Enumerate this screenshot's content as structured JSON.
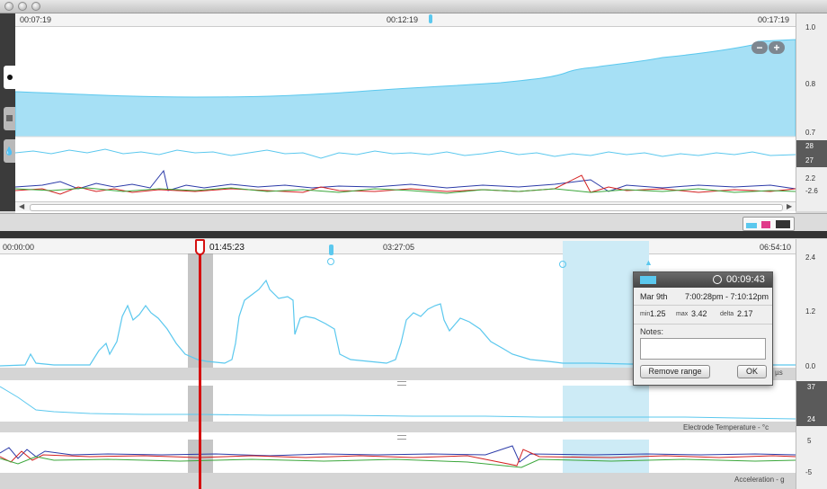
{
  "window": {
    "title": ""
  },
  "overview": {
    "ruler": {
      "start": "00:07:19",
      "mid": "00:12:19",
      "end": "00:17:19"
    },
    "axis": {
      "top": "1.0",
      "mid": "0.8",
      "bottom": "0.7"
    },
    "temp_axis": {
      "top": "28",
      "bottom": "27"
    },
    "accel_axis": {
      "top": "2.2",
      "bottom": "-2.6"
    },
    "zoom_out_label": "−",
    "zoom_in_label": "+"
  },
  "timeline": {
    "start": "00:00:00",
    "cursor": "01:45:23",
    "mid": "03:27:05",
    "end": "06:54:10"
  },
  "eda": {
    "axis": [
      "2.4",
      "1.2",
      "0.0"
    ],
    "label": "y - µs"
  },
  "temperature": {
    "axis": [
      "37",
      "24"
    ],
    "label": "Electrode Temperature - °c"
  },
  "acceleration": {
    "axis": [
      "5",
      "-5"
    ],
    "label": "Acceleration - g"
  },
  "popup": {
    "duration": "00:09:43",
    "date": "Mar 9th",
    "range": "7:00:28pm - 7:10:12pm",
    "min_label": "min",
    "min_value": "1.25",
    "max_label": "max",
    "max_value": "3.42",
    "delta_label": "delta",
    "delta_value": "2.17",
    "notes_label": "Notes:",
    "notes_value": "",
    "remove_button": "Remove range",
    "ok_button": "OK",
    "swatch_color": "#5bc8ee"
  },
  "colors": {
    "eda": "#5bc8ee",
    "selection": "#cdebf6",
    "cursor": "#d51010",
    "accel_x": "#2b3aa8",
    "accel_y": "#d42020",
    "accel_z": "#3aa63a"
  }
}
